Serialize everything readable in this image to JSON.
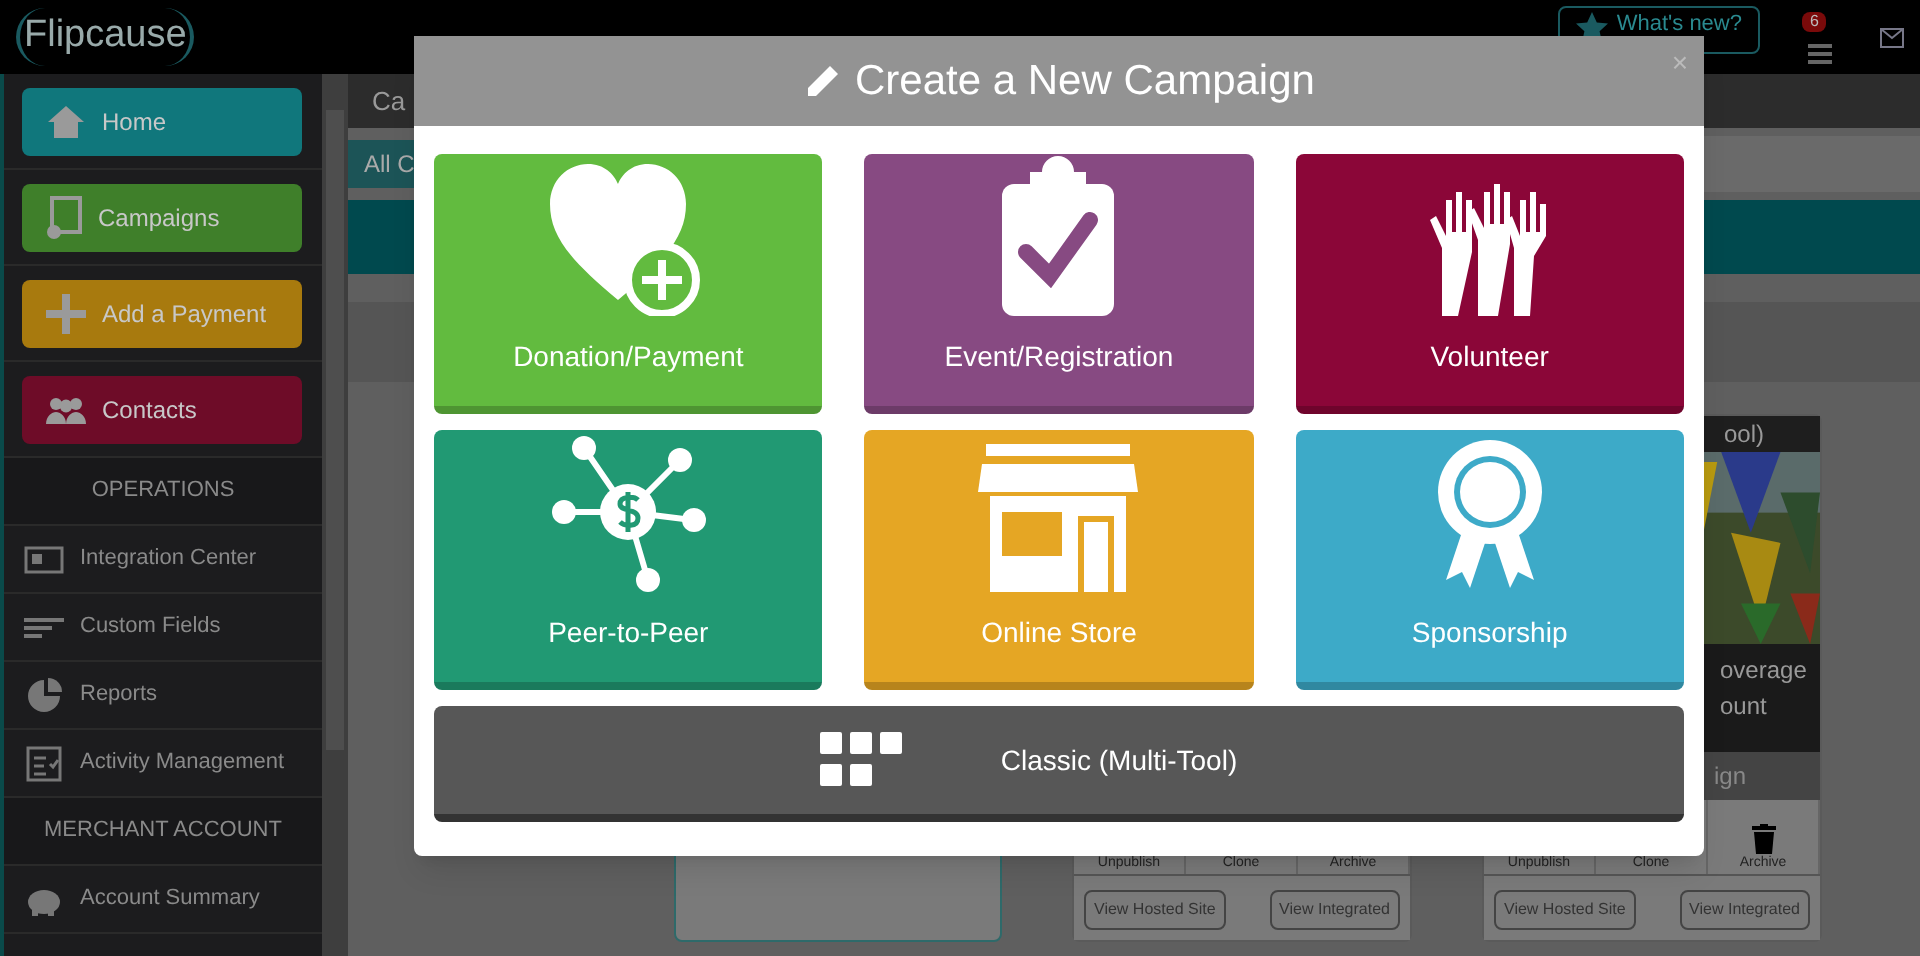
{
  "top_bar": {
    "logo": "Flipcause",
    "whats_new": "What's new?",
    "notification_count": "6"
  },
  "sidebar": {
    "items": [
      {
        "kind": "button",
        "label": "Home",
        "color": "#10777c"
      },
      {
        "kind": "button",
        "label": "Campaigns",
        "color": "#3f7f2a"
      },
      {
        "kind": "button",
        "label": "Add a Payment",
        "color": "#a87a0e"
      },
      {
        "kind": "button",
        "label": "Contacts",
        "color": "#6e0c28"
      },
      {
        "kind": "heading",
        "label": "OPERATIONS"
      },
      {
        "kind": "link",
        "label": "Integration Center"
      },
      {
        "kind": "link",
        "label": "Custom Fields"
      },
      {
        "kind": "link",
        "label": "Reports"
      },
      {
        "kind": "link",
        "label": "Activity Management"
      },
      {
        "kind": "heading",
        "label": "MERCHANT ACCOUNT"
      },
      {
        "kind": "link",
        "label": "Account Summary"
      }
    ]
  },
  "main": {
    "header_title": "Ca",
    "tabs": [
      {
        "label": "All C",
        "selected": true
      }
    ],
    "cards": [
      {
        "kind": "empty"
      },
      {
        "kind": "campaign",
        "actions": [
          "Unpublish",
          "Clone",
          "Archive"
        ],
        "buttons": [
          "View Hosted Site",
          "View Integrated"
        ]
      },
      {
        "kind": "campaign",
        "title": "ool)",
        "caption": [
          "overage",
          "ount"
        ],
        "bar": "ign",
        "actions": [
          "Unpublish",
          "Clone",
          "Archive"
        ],
        "buttons": [
          "View Hosted Site",
          "View Integrated"
        ]
      }
    ]
  },
  "modal": {
    "title": "Create a New Campaign",
    "close": "×",
    "tiles": [
      {
        "label": "Donation/Payment",
        "color": "#62bb3f"
      },
      {
        "label": "Event/Registration",
        "color": "#874a82"
      },
      {
        "label": "Volunteer",
        "color": "#8b0638"
      },
      {
        "label": "Peer-to-Peer",
        "color": "#219973"
      },
      {
        "label": "Online Store",
        "color": "#e5a624"
      },
      {
        "label": "Sponsorship",
        "color": "#3daac8"
      }
    ],
    "classic": {
      "label": "Classic (Multi-Tool)"
    }
  }
}
